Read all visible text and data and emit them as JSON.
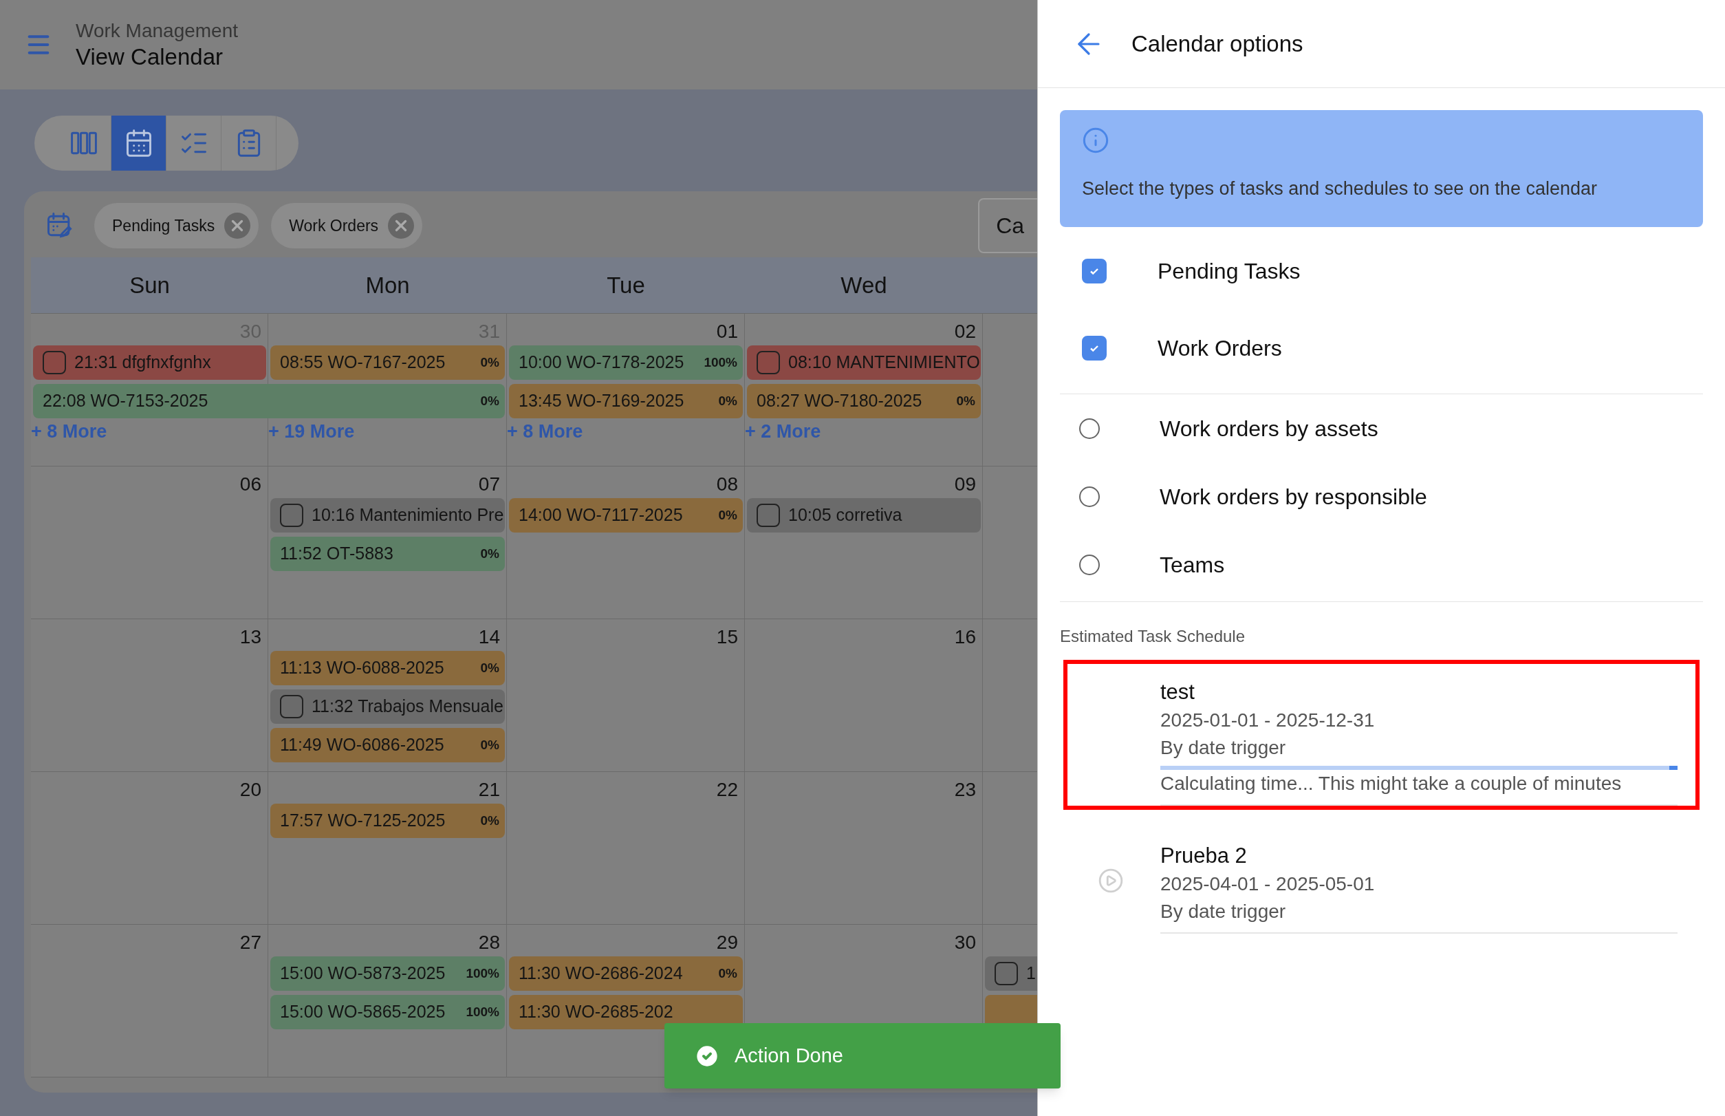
{
  "header": {
    "section": "Work Management",
    "title": "View Calendar"
  },
  "view_buttons": [
    {
      "kind": "columns",
      "selected": false
    },
    {
      "kind": "calendar",
      "selected": true
    },
    {
      "kind": "checklist",
      "selected": false
    },
    {
      "kind": "clipboard",
      "selected": false
    }
  ],
  "filter_chips": [
    "Pending Tasks",
    "Work Orders"
  ],
  "calendar_button": "Ca",
  "weekdays": [
    "Sun",
    "Mon",
    "Tue",
    "Wed"
  ],
  "weeks": [
    {
      "days": [
        {
          "date": "30",
          "muted": true,
          "more": "+ 8 More",
          "events": [
            {
              "kind": "task",
              "label": "21:31 dfgfnxfgnhx",
              "color": "#8b4844"
            },
            {
              "kind": "multi_day",
              "label": "22:08 WO-7153-2025",
              "percent": "0%",
              "color": "#5d7f66"
            }
          ]
        },
        {
          "date": "31",
          "muted": true,
          "more": "+ 19 More",
          "events": [
            {
              "kind": "work_order",
              "label": "08:55 WO-7167-2025",
              "percent": "0%",
              "color": "#8a6a3d"
            }
          ]
        },
        {
          "date": "01",
          "muted": false,
          "more": "+ 8 More",
          "events": [
            {
              "kind": "work_order",
              "label": "10:00 WO-7178-2025",
              "percent": "100%",
              "color": "#5d7f66"
            },
            {
              "kind": "work_order",
              "label": "13:45 WO-7169-2025",
              "percent": "0%",
              "color": "#8a6a3d"
            }
          ]
        },
        {
          "date": "02",
          "muted": false,
          "more": "+ 2 More",
          "events": [
            {
              "kind": "task",
              "label": "08:10 MANTENIMIENTO",
              "color": "#8b4844"
            },
            {
              "kind": "work_order",
              "label": "08:27 WO-7180-2025",
              "percent": "0%",
              "color": "#8a6a3d"
            }
          ]
        }
      ]
    },
    {
      "days": [
        {
          "date": "06",
          "muted": false
        },
        {
          "date": "07",
          "muted": false,
          "events": [
            {
              "kind": "task",
              "label": "10:16 Mantenimiento Pre",
              "color": "#6b6b6b"
            },
            {
              "kind": "work_order",
              "label": "11:52 OT-5883",
              "percent": "0%",
              "color": "#5d7f66"
            }
          ]
        },
        {
          "date": "08",
          "muted": false,
          "events": [
            {
              "kind": "work_order",
              "label": "14:00 WO-7117-2025",
              "percent": "0%",
              "color": "#8a6a3d"
            }
          ]
        },
        {
          "date": "09",
          "muted": false,
          "events": [
            {
              "kind": "task",
              "label": "10:05 corretiva",
              "color": "#6b6b6b"
            }
          ]
        }
      ]
    },
    {
      "days": [
        {
          "date": "13",
          "muted": false
        },
        {
          "date": "14",
          "muted": false,
          "events": [
            {
              "kind": "work_order",
              "label": "11:13 WO-6088-2025",
              "percent": "0%",
              "color": "#8a6a3d"
            },
            {
              "kind": "task",
              "label": "11:32 Trabajos Mensuale",
              "color": "#6b6b6b"
            },
            {
              "kind": "work_order",
              "label": "11:49 WO-6086-2025",
              "percent": "0%",
              "color": "#8a6a3d"
            }
          ]
        },
        {
          "date": "15",
          "muted": false
        },
        {
          "date": "16",
          "muted": false
        }
      ]
    },
    {
      "days": [
        {
          "date": "20",
          "muted": false
        },
        {
          "date": "21",
          "muted": false,
          "events": [
            {
              "kind": "work_order",
              "label": "17:57 WO-7125-2025",
              "percent": "0%",
              "color": "#8a6a3d"
            }
          ]
        },
        {
          "date": "22",
          "muted": false
        },
        {
          "date": "23",
          "muted": false
        }
      ]
    },
    {
      "days": [
        {
          "date": "27",
          "muted": false
        },
        {
          "date": "28",
          "muted": false,
          "events": [
            {
              "kind": "work_order",
              "label": "15:00 WO-5873-2025",
              "percent": "100%",
              "color": "#5d7f66"
            },
            {
              "kind": "work_order",
              "label": "15:00 WO-5865-2025",
              "percent": "100%",
              "color": "#5d7f66"
            }
          ]
        },
        {
          "date": "29",
          "muted": false,
          "events": [
            {
              "kind": "work_order",
              "label": "11:30 WO-2686-2024",
              "percent": "0%",
              "color": "#8a6a3d"
            },
            {
              "kind": "work_order",
              "label": "11:30 WO-2685-202",
              "color": "#8a6a3d"
            }
          ]
        },
        {
          "date": "30",
          "muted": false
        },
        {
          "events": [
            {
              "kind": "task",
              "label": "1",
              "color": "#6b6b6b"
            },
            {
              "kind": "work_order",
              "color": "#8a6a3d"
            }
          ]
        }
      ]
    }
  ],
  "drawer": {
    "title": "Calendar options",
    "info": "Select the types of tasks and schedules to see on the calendar",
    "type_filters": [
      {
        "label": "Pending Tasks",
        "checked": true
      },
      {
        "label": "Work Orders",
        "checked": true
      }
    ],
    "grouping": [
      {
        "label": "Work orders by assets",
        "selected": false
      },
      {
        "label": "Work orders by responsible",
        "selected": false
      },
      {
        "label": "Teams",
        "selected": false
      }
    ],
    "schedule_heading": "Estimated Task Schedule",
    "schedules": [
      {
        "name": "test",
        "dates": "2025-01-01 - 2025-12-31",
        "trigger": "By date trigger",
        "calculating": true,
        "highlighted": true,
        "status": "Calculating time... This might take a couple of minutes"
      },
      {
        "name": "Prueba 2",
        "dates": "2025-04-01 - 2025-05-01",
        "trigger": "By date trigger",
        "calculating": false,
        "highlighted": false
      }
    ]
  },
  "toast": {
    "message": "Action Done"
  }
}
